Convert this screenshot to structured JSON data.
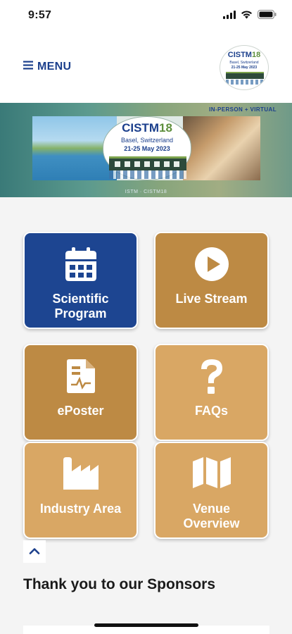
{
  "status_bar": {
    "time": "9:57"
  },
  "header": {
    "menu_label": "MENU"
  },
  "logo": {
    "title_text": "CISTM",
    "title_number": "18",
    "city": "Basel, Switzerland",
    "dates": "21-25 May 2023"
  },
  "banner": {
    "tag": "IN-PERSON + VIRTUAL",
    "badge_title": "CISTM",
    "badge_number": "18",
    "badge_city": "Basel, Switzerland",
    "badge_dates": "21-25 May 2023",
    "footer": "ISTM · CISTM18"
  },
  "tiles": [
    {
      "label": "Scientific Program",
      "icon": "calendar-icon",
      "color": "#1d4591"
    },
    {
      "label": "Live Stream",
      "icon": "play-icon",
      "color": "#bd8a44"
    },
    {
      "label": "ePoster",
      "icon": "poster-document-icon",
      "color": "#bd8a44"
    },
    {
      "label": "FAQs",
      "icon": "question-mark-icon",
      "color": "#d9a764"
    },
    {
      "label": "Industry Area",
      "icon": "factory-icon",
      "color": "#d9a764"
    },
    {
      "label": "Venue Overview",
      "icon": "map-icon",
      "color": "#d9a764"
    }
  ],
  "sponsors": {
    "title": "Thank you to our Sponsors"
  },
  "colors": {
    "navy": "#1b3f8c",
    "gold_dark": "#bd8a44",
    "gold_light": "#d9a764",
    "background": "#f4f4f4"
  }
}
